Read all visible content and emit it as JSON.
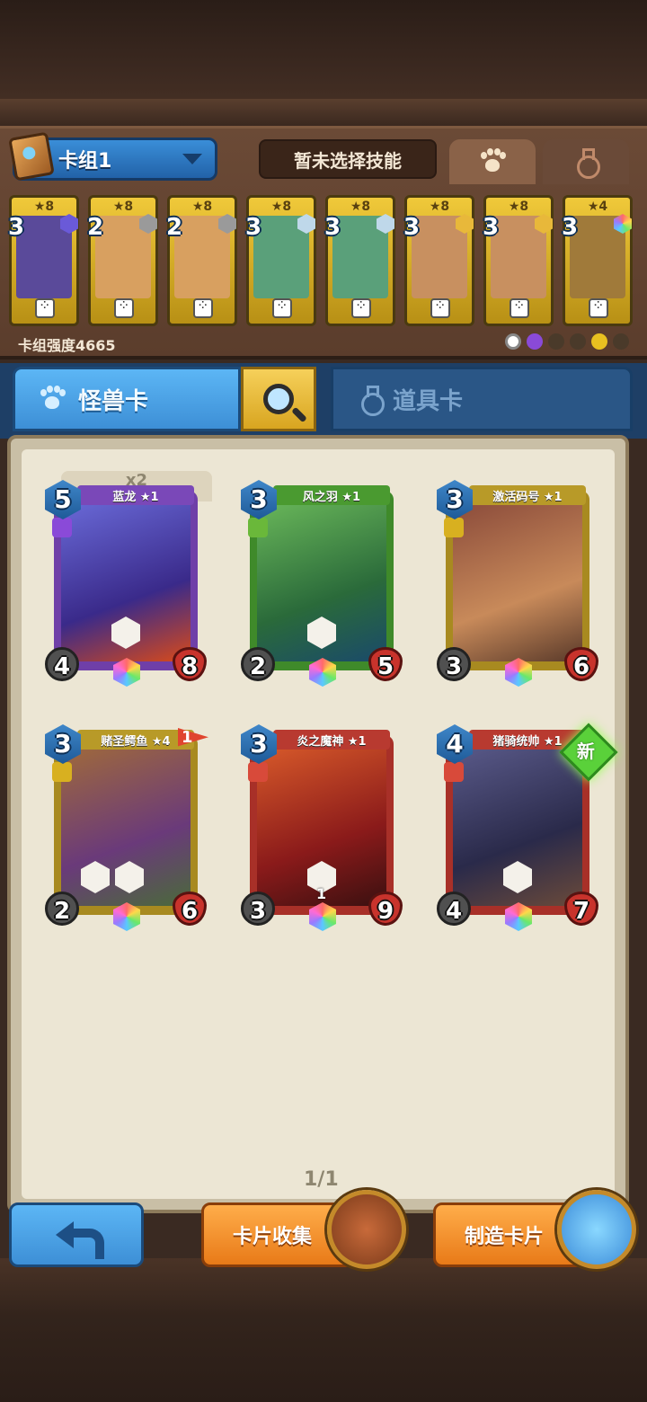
{
  "deck": {
    "name": "卡组1",
    "skill_text": "暂未选择技能",
    "power_label": "卡组强度4665",
    "tabs": [
      "paw-icon",
      "potion-icon"
    ],
    "cards": [
      {
        "stars": "★8",
        "cost": "3",
        "art_color": "#5a4a9a",
        "gem_color": "#6a5ad8"
      },
      {
        "stars": "★8",
        "cost": "2",
        "art_color": "#d8a060",
        "gem_color": "#9a9a9a"
      },
      {
        "stars": "★8",
        "cost": "2",
        "art_color": "#d8a060",
        "gem_color": "#9a9a9a"
      },
      {
        "stars": "★8",
        "cost": "3",
        "art_color": "#5aa07a",
        "gem_color": "#bfd8ea"
      },
      {
        "stars": "★8",
        "cost": "3",
        "art_color": "#5aa07a",
        "gem_color": "#bfd8ea"
      },
      {
        "stars": "★8",
        "cost": "3",
        "art_color": "#c89060",
        "gem_color": "#e8b83a"
      },
      {
        "stars": "★8",
        "cost": "3",
        "art_color": "#c89060",
        "gem_color": "#e8b83a"
      },
      {
        "stars": "★4",
        "cost": "3",
        "art_color": "#a07a3a",
        "gem_color": "#d8a0ff"
      }
    ]
  },
  "category_tabs": {
    "monster": "怪兽卡",
    "item": "道具卡"
  },
  "collection": {
    "copy_count": "x2",
    "page": "1/1",
    "new_badge": "新",
    "cards": [
      {
        "name": "蓝龙 ★1",
        "cost": "5",
        "attack": "4",
        "health": "8",
        "frame": "#6f3fa8",
        "banner": "#7a48b8",
        "art": "#4a3a9a",
        "tribe": "#8a4ad8"
      },
      {
        "name": "风之羽 ★1",
        "cost": "3",
        "attack": "2",
        "health": "5",
        "frame": "#3f8a2a",
        "banner": "#4a9a30",
        "art": "#3a7a3a",
        "tribe": "#6ab83a"
      },
      {
        "name": "激活码号 ★1",
        "cost": "3",
        "attack": "3",
        "health": "6",
        "frame": "#a88a20",
        "banner": "#b89a28",
        "art": "#7a4a3a",
        "tribe": "#d8b020"
      },
      {
        "name": "赌圣鳄鱼 ★4",
        "cost": "3",
        "attack": "2",
        "health": "6",
        "frame": "#a88a20",
        "banner": "#b89a28",
        "art": "#7a5a3a",
        "tribe": "#d8b020",
        "flag": "1"
      },
      {
        "name": "炎之魔神 ★1",
        "cost": "3",
        "attack": "3",
        "health": "9",
        "frame": "#a83028",
        "banner": "#b83a30",
        "art": "#8a2a1a",
        "tribe": "#d84a3a",
        "ability_value": "1"
      },
      {
        "name": "猪骑统帅 ★1",
        "cost": "4",
        "attack": "4",
        "health": "7",
        "frame": "#a83028",
        "banner": "#b83a30",
        "art": "#3a3a5a",
        "tribe": "#d84a3a"
      }
    ]
  },
  "buttons": {
    "card_collection": "卡片收集",
    "craft_card": "制造卡片"
  }
}
